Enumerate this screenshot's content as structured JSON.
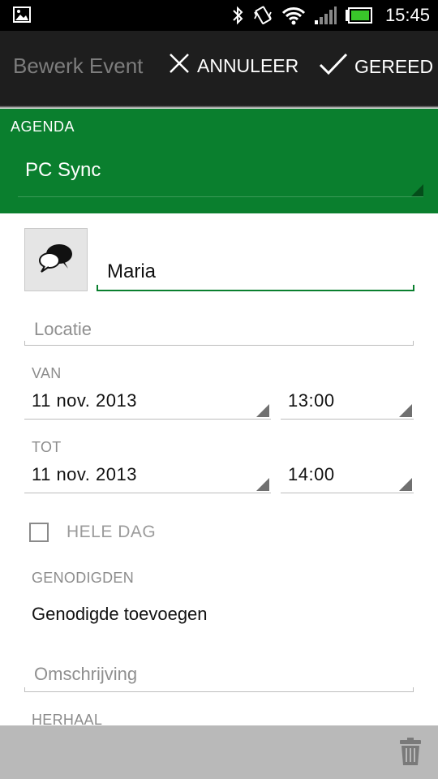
{
  "status_bar": {
    "time": "15:45",
    "icons": [
      "image-icon",
      "bluetooth-icon",
      "vibrate-icon",
      "wifi-icon",
      "signal-icon",
      "battery-icon"
    ]
  },
  "action_bar": {
    "title": "Bewerk Event",
    "cancel_label": "ANNULEER",
    "done_label": "GEREED"
  },
  "agenda": {
    "label": "AGENDA",
    "value": "PC Sync",
    "color": "#0a7f2e"
  },
  "form": {
    "event_icon": "speech-bubbles-icon",
    "title_value": "Maria",
    "location_placeholder": "Locatie",
    "from_label": "VAN",
    "from_date": "11 nov. 2013",
    "from_time": "13:00",
    "to_label": "TOT",
    "to_date": "11 nov. 2013",
    "to_time": "14:00",
    "all_day_label": "HELE DAG",
    "all_day_checked": false,
    "guests_label": "GENODIGDEN",
    "add_guest_label": "Genodigde toevoegen",
    "description_placeholder": "Omschrijving",
    "repeat_label": "HERHAAL"
  },
  "bottom_bar": {
    "delete_icon": "trash-icon"
  }
}
